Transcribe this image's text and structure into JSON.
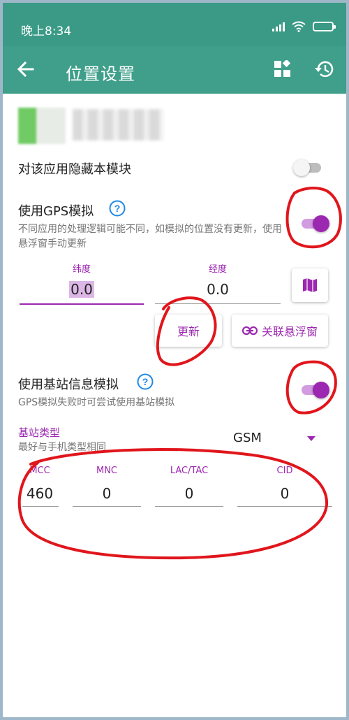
{
  "status_bar": {
    "time": "晚上8:34"
  },
  "toolbar": {
    "title": "位置设置"
  },
  "hide_module": {
    "label": "对该应用隐藏本模块",
    "enabled": false
  },
  "gps": {
    "label": "使用GPS模拟",
    "enabled": true,
    "description": "不同应用的处理逻辑可能不同，如模拟的位置没有更新，使用悬浮窗手动更新",
    "latitude_label": "纬度",
    "latitude_value": "0.0",
    "longitude_label": "经度",
    "longitude_value": "0.0",
    "update_button": "更新",
    "floating_button": "关联悬浮窗"
  },
  "cell": {
    "label": "使用基站信息模拟",
    "enabled": true,
    "description": "GPS模拟失败时可尝试使用基站模拟",
    "type_label": "基站类型",
    "type_hint": "最好与手机类型相同",
    "type_value": "GSM",
    "mcc_label": "MCC",
    "mcc_value": "460",
    "mnc_label": "MNC",
    "mnc_value": "0",
    "lac_label": "LAC/TAC",
    "lac_value": "0",
    "cid_label": "CID",
    "cid_value": "0"
  },
  "colors": {
    "toolbar": "#3f9f8a",
    "accent": "#9c27b0",
    "annotation": "#e0161c"
  },
  "icons": [
    "back-icon",
    "apps-icon",
    "history-icon",
    "help-icon",
    "map-icon",
    "link-icon",
    "dropdown-arrow-icon",
    "wifi-icon",
    "battery-icon",
    "signal-icon"
  ]
}
